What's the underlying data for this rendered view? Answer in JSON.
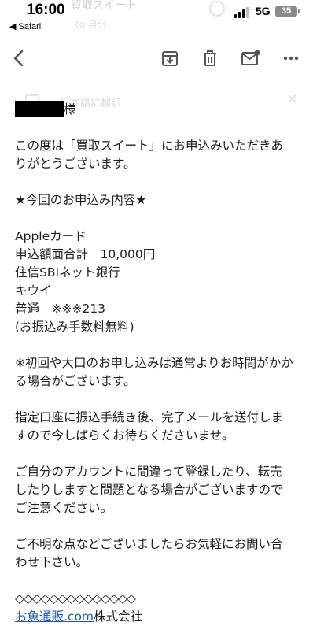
{
  "status_bar": {
    "time": "16:00",
    "back_app": "◀ Safari",
    "network": "5G",
    "battery": "35"
  },
  "ghost": {
    "subject": "買取スイート",
    "sub2": "to 自分",
    "translate": "日本語に翻訳"
  },
  "toolbar": {
    "icons": [
      "back-arrow-icon",
      "archive-icon",
      "trash-icon",
      "mark-unread-icon",
      "more-icon"
    ]
  },
  "email": {
    "recipient_suffix": "様",
    "greeting_1": "この度は「買取スイート」にお申込みいただきあ",
    "greeting_2": "りがとうございます。",
    "section_title": "★今回のお申込み内容★",
    "details": [
      "Appleカード",
      "申込額面合計　10,000円",
      "住信SBIネット銀行",
      "キウイ",
      "普通　※※※213",
      "(お振込み手数料無料)"
    ],
    "note_1": "※初回や大口のお申し込みは通常よりお時間がかか",
    "note_2": "る場合がございます。",
    "transfer_1": "指定口座に振込手続き後、完了メールを送付しま",
    "transfer_2": "すので今しばらくお待ちくださいませ。",
    "caution_1": "ご自分のアカウントに間違って登録したり、転売",
    "caution_2": "したりしますと問題となる場合がございますので",
    "caution_3": "ご注意ください。",
    "inquiry_1": "ご不明な点などございましたらお気軽にお問い合",
    "inquiry_2": "わせ下さい。",
    "divider": "◇◇◇◇◇◇◇◇◇◇◇◇◇◇",
    "company_link": "お魚通販.com",
    "company_suffix": "株式会社"
  }
}
